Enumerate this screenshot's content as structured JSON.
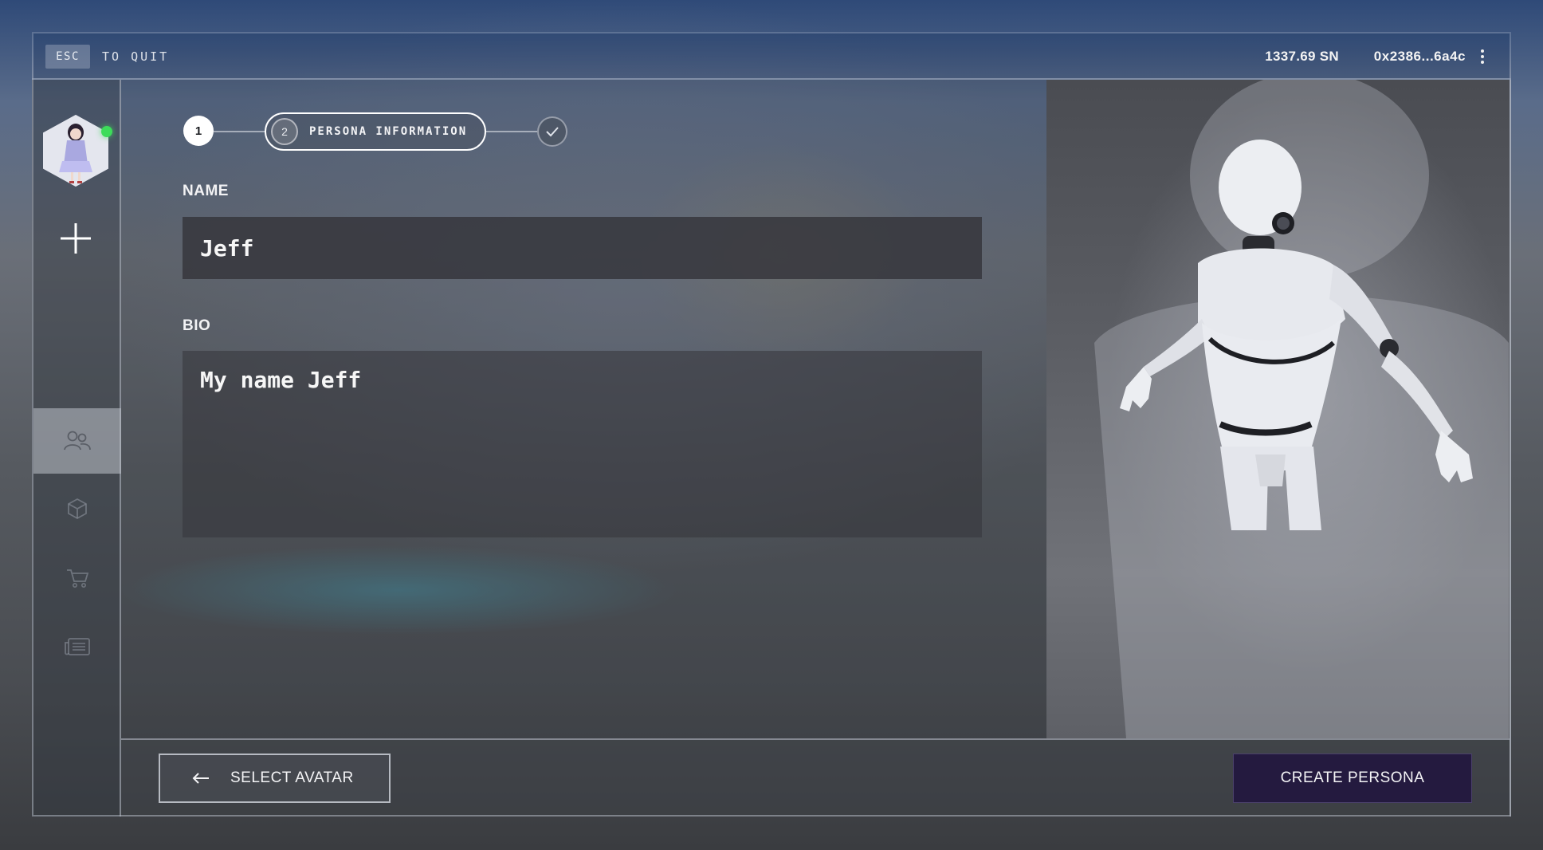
{
  "topbar": {
    "esc_key": "ESC",
    "quit_text": "TO QUIT",
    "balance": "1337.69 SN",
    "wallet_address": "0x2386...6a4c",
    "menu_icon": "vertical-dots-icon"
  },
  "sidebar": {
    "avatar_status": "online",
    "add_icon": "plus-icon",
    "items": [
      {
        "icon": "users-icon",
        "active": true
      },
      {
        "icon": "cube-icon",
        "active": false
      },
      {
        "icon": "cart-icon",
        "active": false
      },
      {
        "icon": "newspaper-icon",
        "active": false
      }
    ]
  },
  "stepper": {
    "steps": [
      {
        "number": "1",
        "state": "done"
      },
      {
        "number": "2",
        "label": "PERSONA INFORMATION",
        "state": "current"
      },
      {
        "icon": "check-icon",
        "state": "pending"
      }
    ]
  },
  "form": {
    "name_label": "NAME",
    "name_value": "Jeff",
    "bio_label": "BIO",
    "bio_value": "My name Jeff"
  },
  "footer": {
    "back_label": "SELECT AVATAR",
    "back_icon": "arrow-left-icon",
    "create_label": "CREATE PERSONA"
  },
  "colors": {
    "create_button_bg": "#241a3f",
    "online_dot": "#3ddc5a",
    "active_nav_bg": "#bec2ca"
  }
}
